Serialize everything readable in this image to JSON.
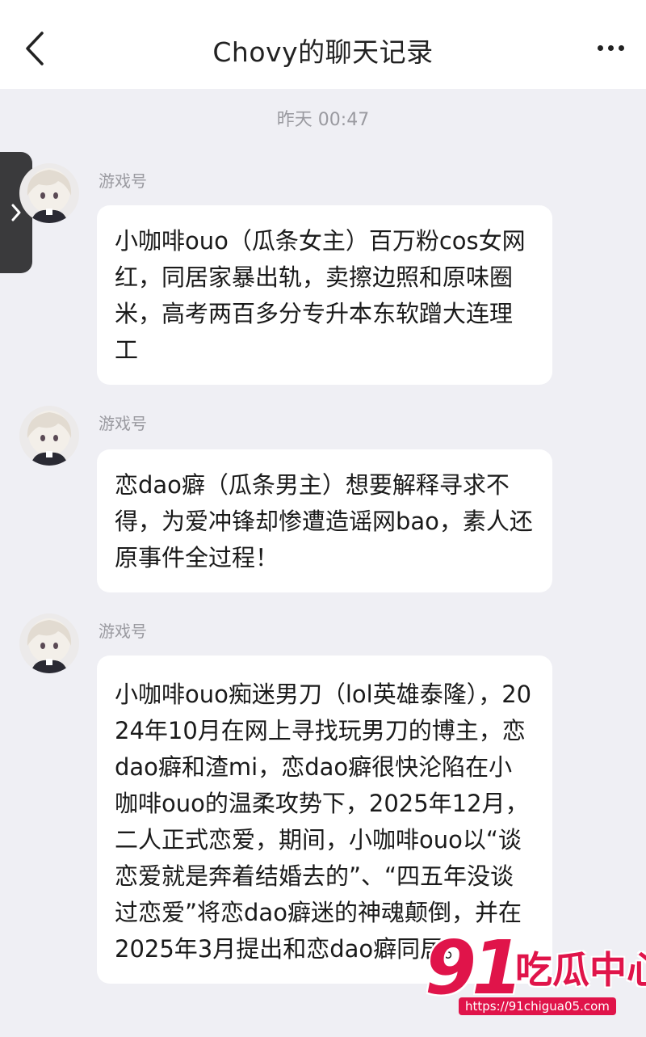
{
  "header": {
    "title": "Chovy的聊天记录",
    "back_icon": "chevron-left-icon",
    "more_icon": "more-dots-icon"
  },
  "timestamp": "昨天 00:47",
  "side_tab_icon": "chevron-right-icon",
  "messages": [
    {
      "sender": "游戏号",
      "text": "小咖啡ouo（瓜条女主）百万粉cos女网红，同居家暴出轨，卖擦边照和原味圈米，高考两百多分专升本东软蹭大连理工"
    },
    {
      "sender": "游戏号",
      "text": "恋dao癖（瓜条男主）想要解释寻求不得，为爱冲锋却惨遭造谣网bao，素人还原事件全过程！"
    },
    {
      "sender": "游戏号",
      "text": "小咖啡ouo痴迷男刀（lol英雄泰隆），2024年10月在网上寻找玩男刀的博主，恋dao癖和渣mi，恋dao癖很快沦陷在小咖啡ouo的温柔攻势下，2025年12月，二人正式恋爱，期间，小咖啡ouo以“谈恋爱就是奔着结婚去的”、“四五年没谈过恋爱”将恋dao癖迷的神魂颠倒，并在2025年3月提出和恋dao癖同居。"
    }
  ],
  "watermark": {
    "number": "91",
    "text": "吃瓜中心",
    "url": "https://91chigua05.com"
  },
  "colors": {
    "background": "#efeff4",
    "bubble": "#ffffff",
    "watermark": "#e0144a"
  }
}
